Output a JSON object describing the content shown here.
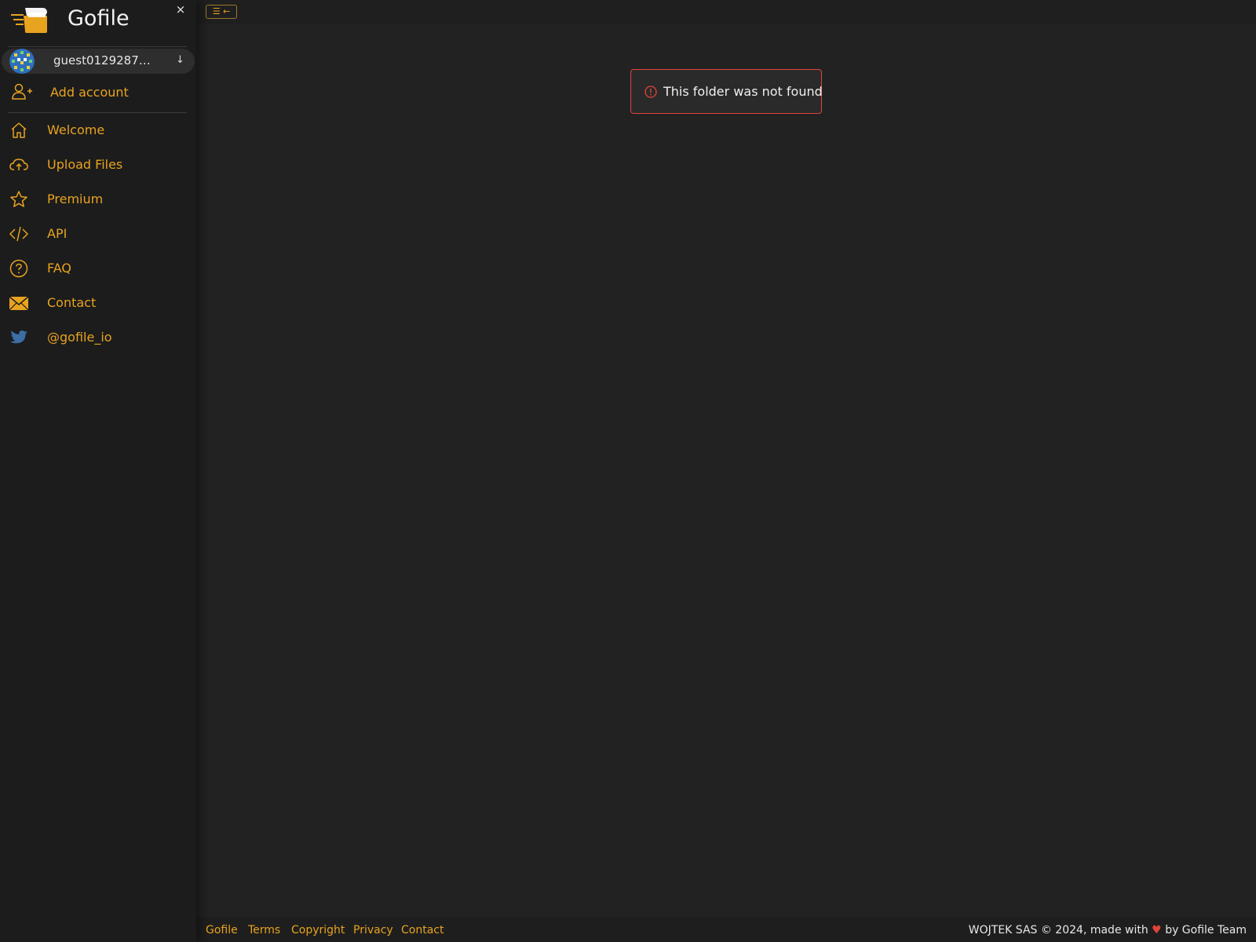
{
  "brand": {
    "name": "Gofile"
  },
  "sidebar": {
    "close_label": "×",
    "account": {
      "name": "guest01292878...",
      "caret": "↓"
    },
    "add_account": {
      "label": "Add account"
    },
    "items": [
      {
        "label": "Welcome",
        "icon": "home-icon"
      },
      {
        "label": "Upload Files",
        "icon": "cloud-upload-icon"
      },
      {
        "label": "Premium",
        "icon": "star-icon"
      },
      {
        "label": "API",
        "icon": "code-icon"
      },
      {
        "label": "FAQ",
        "icon": "question-circle-icon"
      },
      {
        "label": "Contact",
        "icon": "envelope-icon"
      },
      {
        "label": "@gofile_io",
        "icon": "twitter-icon"
      }
    ]
  },
  "topbar": {
    "toggle_label": "☰ ←"
  },
  "alert": {
    "message": "This folder was not found"
  },
  "footer": {
    "links": [
      "Gofile",
      "Terms",
      "Copyright",
      "Privacy",
      "Contact"
    ],
    "copyright_prefix": "WOJTEK SAS © 2024, made with",
    "heart": "♥",
    "copyright_suffix": "by Gofile Team"
  },
  "colors": {
    "accent": "#e8a31f",
    "background": "#222222",
    "sidebar": "#1c1c1c",
    "alert_border": "#e0443a",
    "twitter": "#3b6ea5"
  }
}
